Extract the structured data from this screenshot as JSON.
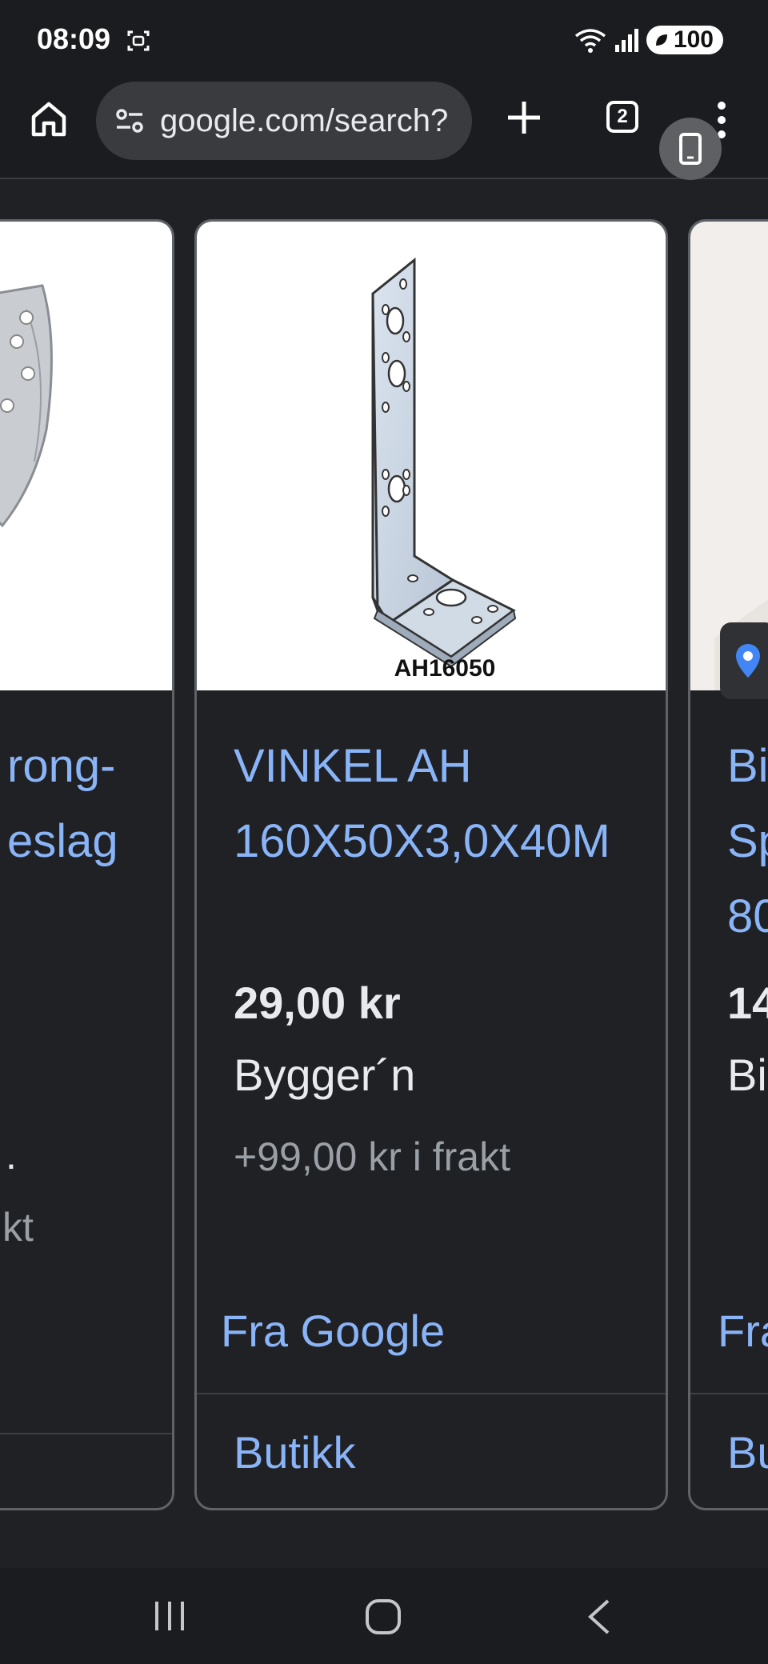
{
  "status_bar": {
    "time": "08:09",
    "battery": "100"
  },
  "browser": {
    "url": "google.com/search?",
    "tab_count": "2"
  },
  "cards": [
    {
      "title_lines": [
        "rong-",
        "eslag"
      ],
      "shipping_fragment": ".",
      "shipping_fragment2": "kt"
    },
    {
      "image_caption": "AH16050",
      "title_lines": [
        "VINKEL AH",
        "160X50X3,0X40M"
      ],
      "price": "29,00 kr",
      "store": "Bygger´n",
      "shipping": "+99,00 kr i frakt",
      "source": "Fra Google",
      "shop_button": "Butikk"
    },
    {
      "title_lines": [
        "Bi",
        "Sp",
        "80"
      ],
      "price": "14",
      "store": "Bi",
      "source": "Fra",
      "shop_button": "Bu"
    }
  ],
  "icons": {
    "home": "home-icon",
    "tune": "tune-icon",
    "plus": "plus-icon",
    "menu": "more-vert-icon",
    "mobile": "mobile-view-icon",
    "pin": "location-pin-icon"
  },
  "colors": {
    "link": "#8ab4f8",
    "background": "#202124",
    "pin": "#4285f4"
  }
}
